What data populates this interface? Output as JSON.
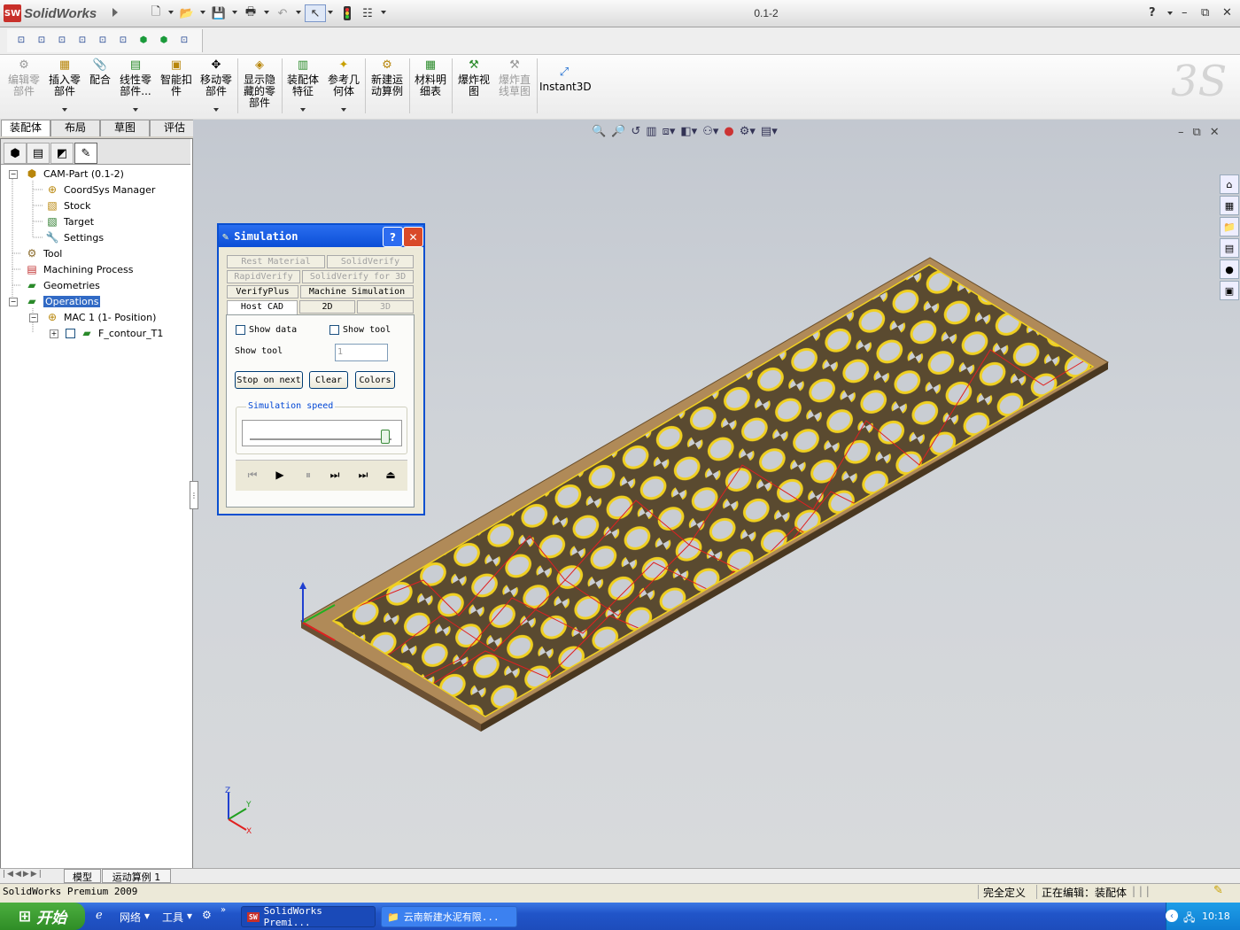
{
  "titlebar": {
    "app_name": "SolidWorks",
    "document_title": "0.1-2",
    "help": "?"
  },
  "command_manager": {
    "items": [
      {
        "label": "编辑零\n部件",
        "disabled": true
      },
      {
        "label": "插入零\n部件",
        "disabled": false
      },
      {
        "label": "配合",
        "disabled": false
      },
      {
        "label": "线性零\n部件...",
        "disabled": false
      },
      {
        "label": "智能扣\n件",
        "disabled": false
      },
      {
        "label": "移动零\n部件",
        "disabled": false
      },
      {
        "label": "显示隐\n藏的零\n部件",
        "disabled": false
      },
      {
        "label": "装配体\n特征",
        "disabled": false
      },
      {
        "label": "参考几\n何体",
        "disabled": false
      },
      {
        "label": "新建运\n动算例",
        "disabled": false
      },
      {
        "label": "材料明\n细表",
        "disabled": false
      },
      {
        "label": "爆炸视\n图",
        "disabled": false
      },
      {
        "label": "爆炸直\n线草图",
        "disabled": true
      },
      {
        "label": "Instant3D",
        "disabled": false
      }
    ]
  },
  "tabs": [
    "装配体",
    "布局",
    "草图",
    "评估"
  ],
  "tree": {
    "root": "CAM-Part (0.1-2)",
    "coordsys": "CoordSys Manager",
    "stock": "Stock",
    "target": "Target",
    "settings": "Settings",
    "tool": "Tool",
    "machining": "Machining Process",
    "geometries": "Geometries",
    "operations": "Operations",
    "mac": "MAC 1 (1- Position)",
    "contour": "F_contour_T1"
  },
  "dialog": {
    "title": "Simulation",
    "tabs": {
      "rest_material": "Rest Material",
      "solidverify": "SolidVerify",
      "rapidverify": "RapidVerify",
      "solidverify3d": "SolidVerify for 3D",
      "verifyplus": "VerifyPlus",
      "machine_sim": "Machine Simulation",
      "host_cad": "Host CAD",
      "t2d": "2D",
      "t3d": "3D"
    },
    "show_data": "Show data",
    "show_tool_chk": "Show tool",
    "show_tool_label": "Show tool",
    "show_tool_value": "1",
    "stop_on_next": "Stop on next",
    "clear": "Clear",
    "colors": "Colors",
    "speed_group": "Simulation speed",
    "speed_value": 0.95
  },
  "bottom_tabs": [
    "模型",
    "运动算例 1"
  ],
  "statusbar": {
    "app": "SolidWorks Premium 2009",
    "defined": "完全定义",
    "editing": "正在编辑：装配体"
  },
  "taskbar": {
    "start": "开始",
    "network": "网络",
    "tools": "工具",
    "task1": "SolidWorks Premi...",
    "task2": "云南新建水泥有限...",
    "clock": "10:18"
  },
  "colors": {
    "accent": "#316ac5",
    "toolpath_red": "#e02020",
    "toolpath_yellow": "#f0d020",
    "wood": "#b08a58"
  }
}
